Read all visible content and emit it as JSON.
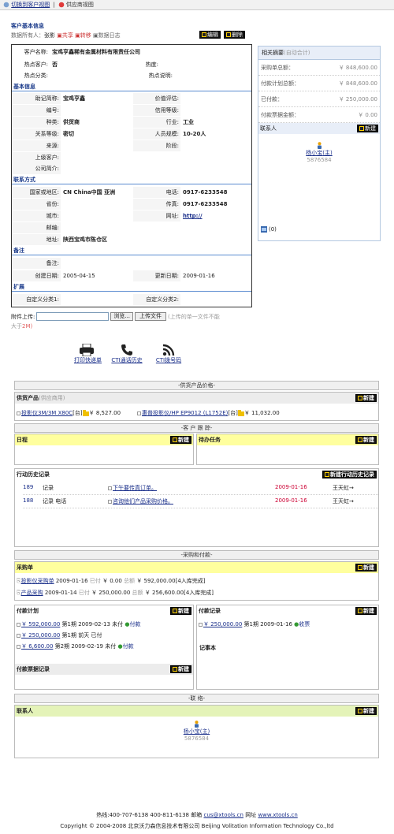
{
  "toolbar": {
    "switch_customer": "切换到客户视图",
    "supplier_view": "供应商视图"
  },
  "basic": {
    "title": "客户基本信息",
    "owner_label": "数据所有人：",
    "owner": "张影",
    "share": "共享",
    "transfer": "转移",
    "log": "数据日志",
    "edit": "编辑",
    "delete": "删除"
  },
  "customer": {
    "name_label": "客户名称:",
    "name": "宝鸡亨鑫稀有金属材料有限责任公司",
    "hot_label": "热点客户:",
    "hot": "否",
    "heat_label": "热度:",
    "hotcat_label": "热点分类:",
    "hotdesc_label": "热点说明:"
  },
  "basic_info": {
    "group": "基本信息",
    "abbr_label": "助记简称:",
    "abbr": "宝鸡亨鑫",
    "price_label": "价值评估:",
    "no_label": "编号:",
    "credit_label": "信用等级:",
    "type_label": "种类:",
    "type": "供货商",
    "industry_label": "行业:",
    "industry": "工业",
    "rel_label": "关系等级:",
    "rel": "密切",
    "staff_label": "人员规模:",
    "staff": "10-20人",
    "source_label": "来源:",
    "stage_label": "阶段:",
    "parent_label": "上级客户:",
    "intro_label": "公司简介:"
  },
  "contact": {
    "group": "联系方式",
    "region_label": "国家或地区:",
    "region": "CN China中国  亚洲",
    "phone_label": "电话:",
    "phone": "0917-6233548",
    "prov_label": "省份:",
    "fax_label": "传真:",
    "fax": "0917-6233548",
    "city_label": "城市:",
    "web_label": "网址:",
    "web": "http://",
    "zip_label": "邮编:",
    "addr_label": "地址:",
    "addr": "陕西宝鸡市陈仓区"
  },
  "remark": {
    "group": "备注",
    "note_label": "备注:",
    "created_label": "创建日期:",
    "created": "2005-04-15",
    "updated_label": "更新日期:",
    "updated": "2009-01-16"
  },
  "ext": {
    "group": "扩展",
    "c1_label": "自定义分类1:",
    "c2_label": "自定义分类2:"
  },
  "upload": {
    "label": "附件上传:",
    "browse": "浏览...",
    "upload": "上传文件",
    "hint": "(上传的单一文件不能",
    "hint2a": "大于",
    "hint2b": "2M)"
  },
  "actions": {
    "print": "打印快递单",
    "cti_history": "CTI通话历史",
    "cti_dial": "CTI拨号码"
  },
  "summary": {
    "title": "相关摘要",
    "auto": "(自动合计)",
    "rows": [
      {
        "label": "采购单总额：",
        "value": "￥ 848,600.00"
      },
      {
        "label": "付款计划总额：",
        "value": "￥ 848,600.00"
      },
      {
        "label": "已付款：",
        "value": "￥ 250,000.00"
      },
      {
        "label": "付款票据金额：",
        "value": "￥ 0.00"
      }
    ],
    "contact_title": "联系人",
    "new": "新建",
    "person_name": "杨小宝",
    "person_role": "(主)",
    "person_phone": "5876584",
    "count": "(0)"
  },
  "products": {
    "header": "-供货产品价格-",
    "title": "供货产品",
    "subtitle": "(供应商用)",
    "new": "新建",
    "items": [
      {
        "name": "投影仪3M/3M X80C",
        "tag": "[台]",
        "price": "￥ 8,527.00"
      },
      {
        "name": "惠普投影仪/HP EP9012 (L1752E)",
        "tag": "[台]",
        "price": "￥ 11,032.00"
      }
    ]
  },
  "followup": {
    "header": "-客 户 跟 踪-",
    "schedule": "日程",
    "tasks": "待办任务",
    "new": "新建",
    "history_title": "行动历史记录",
    "history_new": "新建行动历史记录",
    "history": [
      {
        "id": "189",
        "type": "记录",
        "sub": "",
        "text": "下午要传真订单。",
        "date": "2009-01-16",
        "user": "王天虹→"
      },
      {
        "id": "188",
        "type": "记录",
        "sub": "电话",
        "text": "咨询他们产品采购价格。",
        "date": "2009-01-16",
        "user": "王天虹→"
      }
    ]
  },
  "purchase": {
    "header": "-采购和付款-",
    "title": "采购单",
    "new": "新建",
    "rows": [
      {
        "name": "投影仪采购单",
        "date": "2009-01-16",
        "paid_label": "已付",
        "paid": "￥ 0.00",
        "total_label": "总额",
        "total": "￥ 592,000.00",
        "status": "[4入库完成]"
      },
      {
        "name": "产品采购",
        "date": "2009-01-14",
        "paid_label": "已付",
        "paid": "￥ 250,000.00",
        "total_label": "总额",
        "total": "￥ 256,600.00",
        "status": "[4入库完成]"
      }
    ],
    "plan_title": "付款计划",
    "plans": [
      {
        "amount": "￥ 592,000.00",
        "text1": "第1期 2009-02-13 未付",
        "pay": "付款"
      },
      {
        "amount": "￥ 250,000.00",
        "text1": "第1期 前天 已付",
        "pay": ""
      },
      {
        "amount": "￥ 6,600.00",
        "text1": "第2期 2009-02-19 未付",
        "pay": "付款"
      }
    ],
    "record_title": "付款记录",
    "records": [
      {
        "amount": "￥ 250,000.00",
        "text": "第1期 2009-01-16",
        "collect": "收票"
      }
    ],
    "bill_title": "付款票据记录",
    "notebook_title": "记事本"
  },
  "contacts": {
    "header": "-联 络-",
    "title": "联系人",
    "new": "新建",
    "person_name": "杨小宝",
    "person_role": "(主)",
    "person_phone": "5876584"
  },
  "footer": {
    "line1a": "热线:400-707-6138  400-811-6138 邮箱",
    "email": "cus@xtools.cn",
    "line1b": "网址",
    "site": "www.xtools.cn",
    "line2": "Copyright © 2004-2008  北京沃力森信息技术有限公司  Beijing Volitation Information Technology Co.,ltd"
  }
}
